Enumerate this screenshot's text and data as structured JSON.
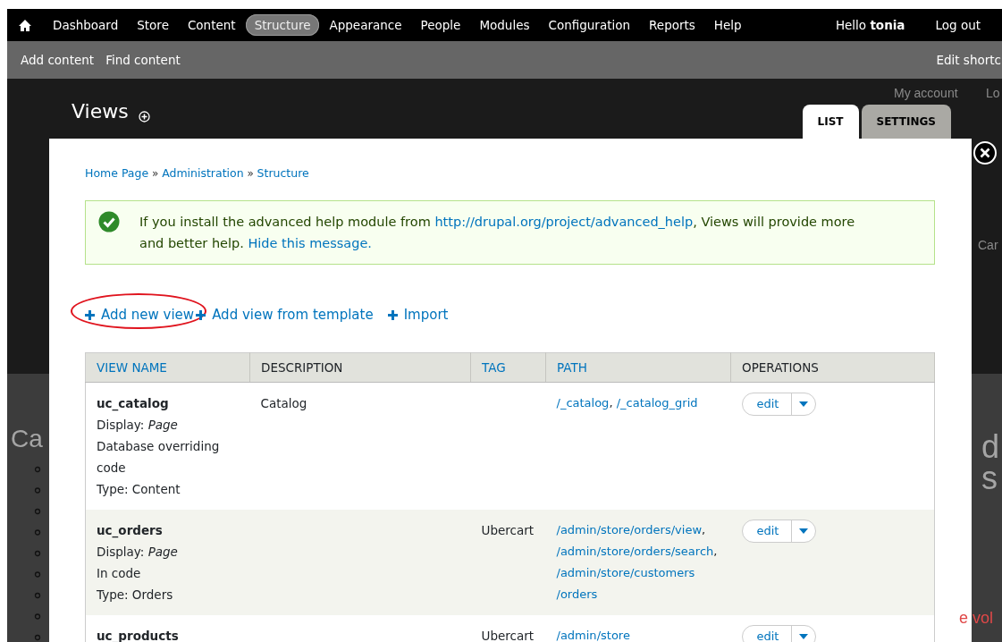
{
  "toolbar": {
    "menu": [
      {
        "label": "Dashboard",
        "selected": false
      },
      {
        "label": "Store",
        "selected": false
      },
      {
        "label": "Content",
        "selected": false
      },
      {
        "label": "Structure",
        "selected": true
      },
      {
        "label": "Appearance",
        "selected": false
      },
      {
        "label": "People",
        "selected": false
      },
      {
        "label": "Modules",
        "selected": false
      },
      {
        "label": "Configuration",
        "selected": false
      },
      {
        "label": "Reports",
        "selected": false
      },
      {
        "label": "Help",
        "selected": false
      }
    ],
    "greeting": "Hello **tonia**",
    "logout": "Log out"
  },
  "shortcuts": {
    "items": [
      "Add content",
      "Find content"
    ],
    "edit": "Edit shortc"
  },
  "background_page": {
    "account_links": [
      "My account",
      "Lo"
    ],
    "fragments": [
      "Ca",
      "Car",
      "d",
      "s",
      "e vol"
    ]
  },
  "page_title": "Views",
  "tabs": [
    {
      "label": "LIST",
      "selected": true
    },
    {
      "label": "SETTINGS",
      "selected": false
    }
  ],
  "breadcrumb": {
    "items": [
      "Home Page",
      "Administration",
      "Structure"
    ],
    "separator": "»"
  },
  "message": {
    "before": "If you install the advanced help module from ",
    "link": "http://drupal.org/project/advanced_help",
    "after": ", Views will provide more and better help.",
    "hide": "Hide this message."
  },
  "actions": [
    {
      "label": "Add new view",
      "highlighted": true
    },
    {
      "label": "Add view from template",
      "highlighted": false
    },
    {
      "label": "Import",
      "highlighted": false
    }
  ],
  "table": {
    "columns": [
      {
        "label": "VIEW NAME",
        "sortable": true
      },
      {
        "label": "DESCRIPTION",
        "sortable": false
      },
      {
        "label": "TAG",
        "sortable": true
      },
      {
        "label": "PATH",
        "sortable": true
      },
      {
        "label": "OPERATIONS",
        "sortable": false
      }
    ],
    "path_separator": ",",
    "rows": [
      {
        "name": "uc_catalog",
        "details": [
          "Display: *Page*",
          "Database overriding code",
          "Type: Content"
        ],
        "description": "Catalog",
        "tag": "",
        "paths": [
          "/_catalog",
          "/_catalog_grid"
        ],
        "operation": "edit"
      },
      {
        "name": "uc_orders",
        "details": [
          "Display: *Page*",
          "In code",
          "Type: Orders"
        ],
        "description": "",
        "tag": "Ubercart",
        "paths": [
          "/admin/store/orders/view",
          "/admin/store/orders/search",
          "/admin/store/customers/orders"
        ],
        "operation": "edit"
      },
      {
        "name": "uc_products",
        "details": [],
        "description": "",
        "tag": "Ubercart",
        "paths": [
          "/admin/store"
        ],
        "operation": "edit"
      }
    ]
  }
}
